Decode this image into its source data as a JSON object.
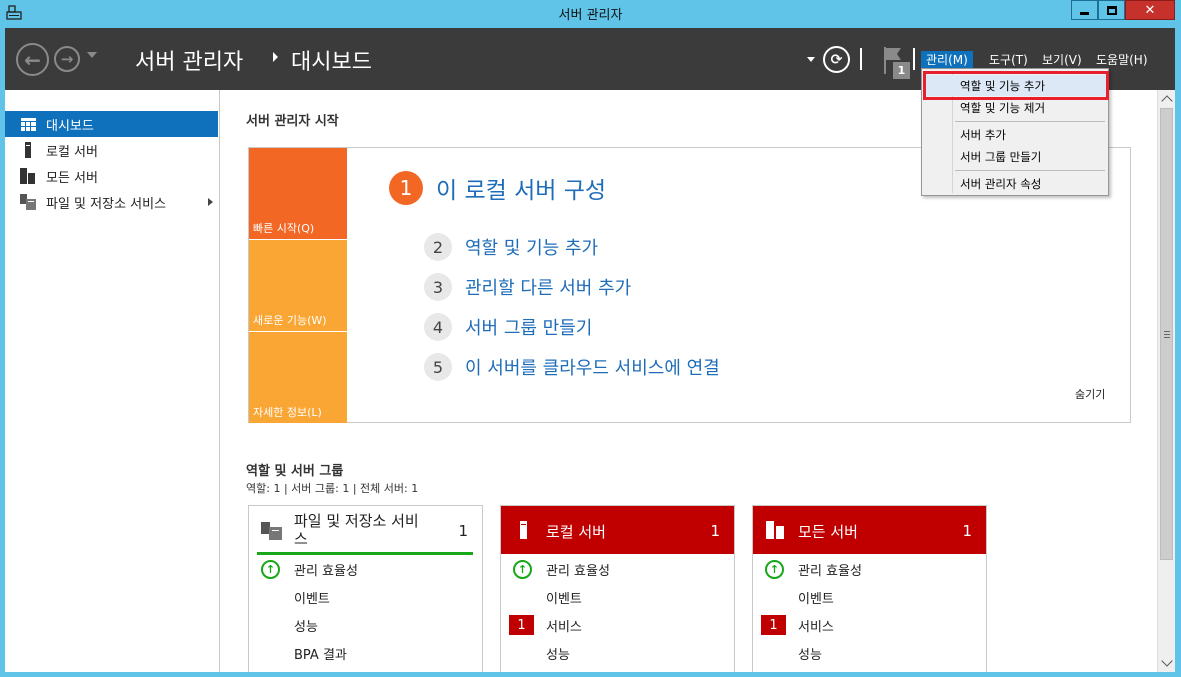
{
  "window": {
    "title": "서버 관리자",
    "close_glyph": "✕"
  },
  "header": {
    "breadcrumb_root": "서버 관리자",
    "breadcrumb_page": "대시보드",
    "flag_count": "1",
    "menus": [
      {
        "label": "관리(M)",
        "active": true
      },
      {
        "label": "도구(T)",
        "active": false
      },
      {
        "label": "보기(V)",
        "active": false
      },
      {
        "label": "도움말(H)",
        "active": false
      }
    ]
  },
  "sidebar": {
    "items": [
      {
        "label": "대시보드",
        "icon": "dashboard-icon",
        "selected": true
      },
      {
        "label": "로컬 서버",
        "icon": "server-icon",
        "selected": false
      },
      {
        "label": "모든 서버",
        "icon": "servers-icon",
        "selected": false
      },
      {
        "label": "파일 및 저장소 서비스",
        "icon": "file-storage-icon",
        "selected": false,
        "has_submenu": true
      }
    ]
  },
  "main": {
    "heading": "서버 관리자 시작",
    "quickstart": {
      "tiles": [
        "빠른 시작(Q)",
        "새로운 기능(W)",
        "자세한 정보(L)"
      ],
      "title_num": "1",
      "title": "이 로컬 서버 구성",
      "steps": [
        {
          "num": "2",
          "label": "역할 및 기능 추가"
        },
        {
          "num": "3",
          "label": "관리할 다른 서버 추가"
        },
        {
          "num": "4",
          "label": "서버 그룹 만들기"
        },
        {
          "num": "5",
          "label": "이 서버를 클라우드 서비스에 연결"
        }
      ],
      "hide_label": "숨기기"
    },
    "roles": {
      "heading": "역할 및 서버 그룹",
      "subtitle": "역할: 1   |   서버 그룹: 1   |   전체 서버: 1",
      "cards": [
        {
          "title_line1": "파일 및 저장소 서비",
          "title_line2": "스",
          "count": "1",
          "style": "white",
          "rows": [
            {
              "label": "관리 효율성",
              "status": "ok"
            },
            {
              "label": "이벤트",
              "status": "none"
            },
            {
              "label": "성능",
              "status": "none"
            },
            {
              "label": "BPA 결과",
              "status": "none"
            }
          ]
        },
        {
          "title_line1": "로컬 서버",
          "title_line2": "",
          "count": "1",
          "style": "red",
          "rows": [
            {
              "label": "관리 효율성",
              "status": "ok"
            },
            {
              "label": "이벤트",
              "status": "none"
            },
            {
              "label": "서비스",
              "status": "error",
              "badge": "1"
            },
            {
              "label": "성능",
              "status": "none"
            }
          ]
        },
        {
          "title_line1": "모든 서버",
          "title_line2": "",
          "count": "1",
          "style": "red",
          "rows": [
            {
              "label": "관리 효율성",
              "status": "ok"
            },
            {
              "label": "이벤트",
              "status": "none"
            },
            {
              "label": "서비스",
              "status": "error",
              "badge": "1"
            },
            {
              "label": "성능",
              "status": "none"
            }
          ]
        }
      ]
    }
  },
  "dropdown": {
    "items": [
      {
        "label": "역할 및 기능 추가",
        "highlighted": true
      },
      {
        "label": "역할 및 기능 제거",
        "highlighted": false
      },
      {
        "label": "서버 추가",
        "highlighted": false
      },
      {
        "label": "서버 그룹 만들기",
        "highlighted": false
      },
      {
        "label": "서버 관리자 속성",
        "highlighted": false
      }
    ]
  },
  "colors": {
    "titlebar": "#5fc4e8",
    "header_bg": "#3b3b3b",
    "accent_blue": "#0f71bc",
    "link_blue": "#1f6db8",
    "tile_orange": "#f26723",
    "tile_amber": "#faa634",
    "alert_red": "#c00000",
    "ok_green": "#18a718",
    "callout_red": "#e8202d"
  }
}
